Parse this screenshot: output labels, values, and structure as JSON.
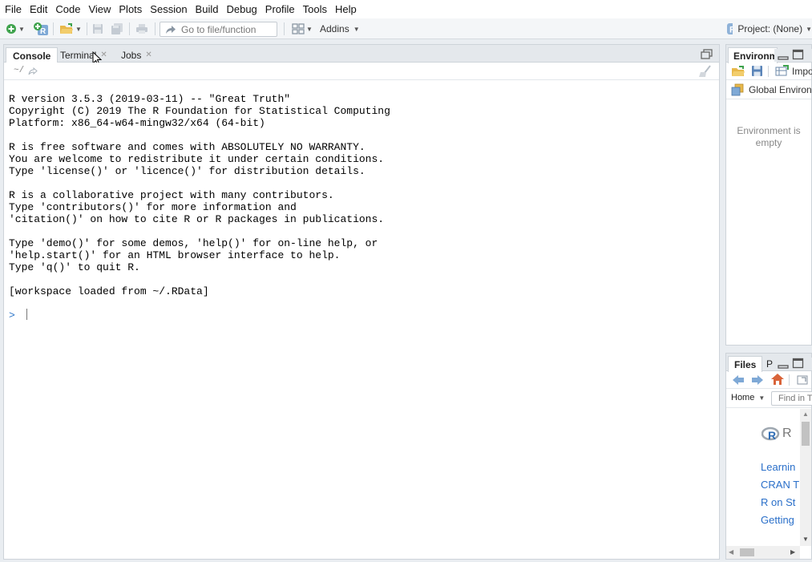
{
  "menu": [
    "File",
    "Edit",
    "Code",
    "View",
    "Plots",
    "Session",
    "Build",
    "Debug",
    "Profile",
    "Tools",
    "Help"
  ],
  "toolbar": {
    "goto_placeholder": "Go to file/function",
    "addins_label": "Addins",
    "project_label": "Project: (None)"
  },
  "console": {
    "tabs": [
      {
        "label": "Console",
        "active": true,
        "closable": false
      },
      {
        "label": "Terminal",
        "active": false,
        "closable": true
      },
      {
        "label": "Jobs",
        "active": false,
        "closable": true
      }
    ],
    "path": "~/",
    "output_lines": [
      "R version 3.5.3 (2019-03-11) -- \"Great Truth\"",
      "Copyright (C) 2019 The R Foundation for Statistical Computing",
      "Platform: x86_64-w64-mingw32/x64 (64-bit)",
      "",
      "R is free software and comes with ABSOLUTELY NO WARRANTY.",
      "You are welcome to redistribute it under certain conditions.",
      "Type 'license()' or 'licence()' for distribution details.",
      "",
      "R is a collaborative project with many contributors.",
      "Type 'contributors()' for more information and",
      "'citation()' on how to cite R or R packages in publications.",
      "",
      "Type 'demo()' for some demos, 'help()' for on-line help, or",
      "'help.start()' for an HTML browser interface to help.",
      "Type 'q()' to quit R.",
      "",
      "[workspace loaded from ~/.RData]"
    ],
    "prompt": ">"
  },
  "environment": {
    "tab_label": "Environm",
    "import_label": "Impo",
    "scope_label": "Global Environm",
    "empty_message": "Environment is empty"
  },
  "files": {
    "tabs": [
      "Files",
      "P"
    ],
    "home_label": "Home",
    "find_placeholder": "Find in T",
    "r_logo_text": "R",
    "links": [
      "Learnin",
      "CRAN T",
      "R on St",
      "Getting"
    ]
  },
  "colors": {
    "accent_blue": "#2f77c9",
    "prompt_blue": "#2f77c9",
    "link_blue": "#2a6fc9",
    "pane_border": "#cdd3d9"
  }
}
